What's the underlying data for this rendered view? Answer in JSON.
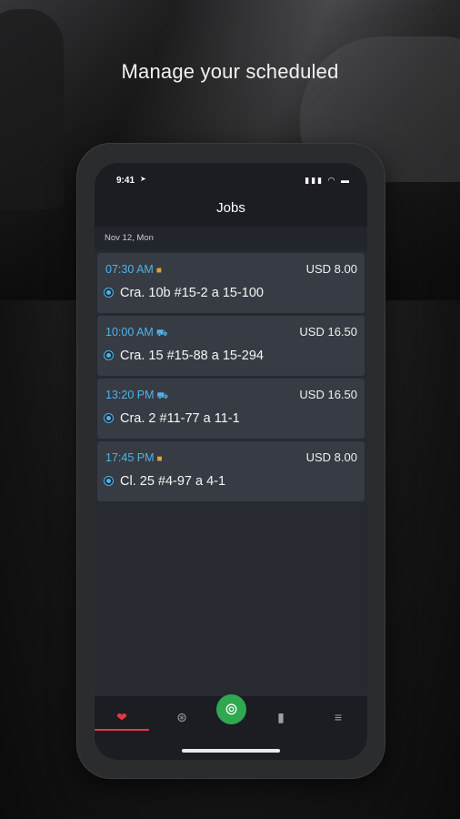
{
  "headline": "Manage your scheduled",
  "status": {
    "time": "9:41",
    "location_glyph": "➤",
    "icons": "▮▮▮ ◠ ▬"
  },
  "nav": {
    "title": "Jobs"
  },
  "date_header": "Nov 12, Mon",
  "jobs": [
    {
      "time": "07:30 AM",
      "icon": "package-icon",
      "price": "USD 8.00",
      "address": "Cra. 10b #15-2 a 15-100"
    },
    {
      "time": "10:00 AM",
      "icon": "car-icon",
      "price": "USD 16.50",
      "address": "Cra. 15 #15-88 a 15-294"
    },
    {
      "time": "13:20 PM",
      "icon": "car-icon",
      "price": "USD 16.50",
      "address": "Cra. 2 #11-77 a 11-1"
    },
    {
      "time": "17:45 PM",
      "icon": "package-icon",
      "price": "USD 8.00",
      "address": "Cl. 25 #4-97 a 4-1"
    }
  ],
  "tabs": [
    {
      "name": "jobs-tab",
      "icon": "heart-badge-icon",
      "glyph": "❤"
    },
    {
      "name": "explore-tab",
      "icon": "compass-icon",
      "glyph": "⊛"
    },
    {
      "name": "drive-tab",
      "icon": "steering-wheel-icon",
      "glyph": "⊚"
    },
    {
      "name": "stats-tab",
      "icon": "bar-chart-icon",
      "glyph": "▮"
    },
    {
      "name": "menu-tab",
      "icon": "menu-icon",
      "glyph": "≡"
    }
  ],
  "colors": {
    "accent_blue": "#4fb3e8",
    "active_red": "#e23b3b",
    "drive_green": "#2fa84f",
    "package_gold": "#d9a63c"
  }
}
